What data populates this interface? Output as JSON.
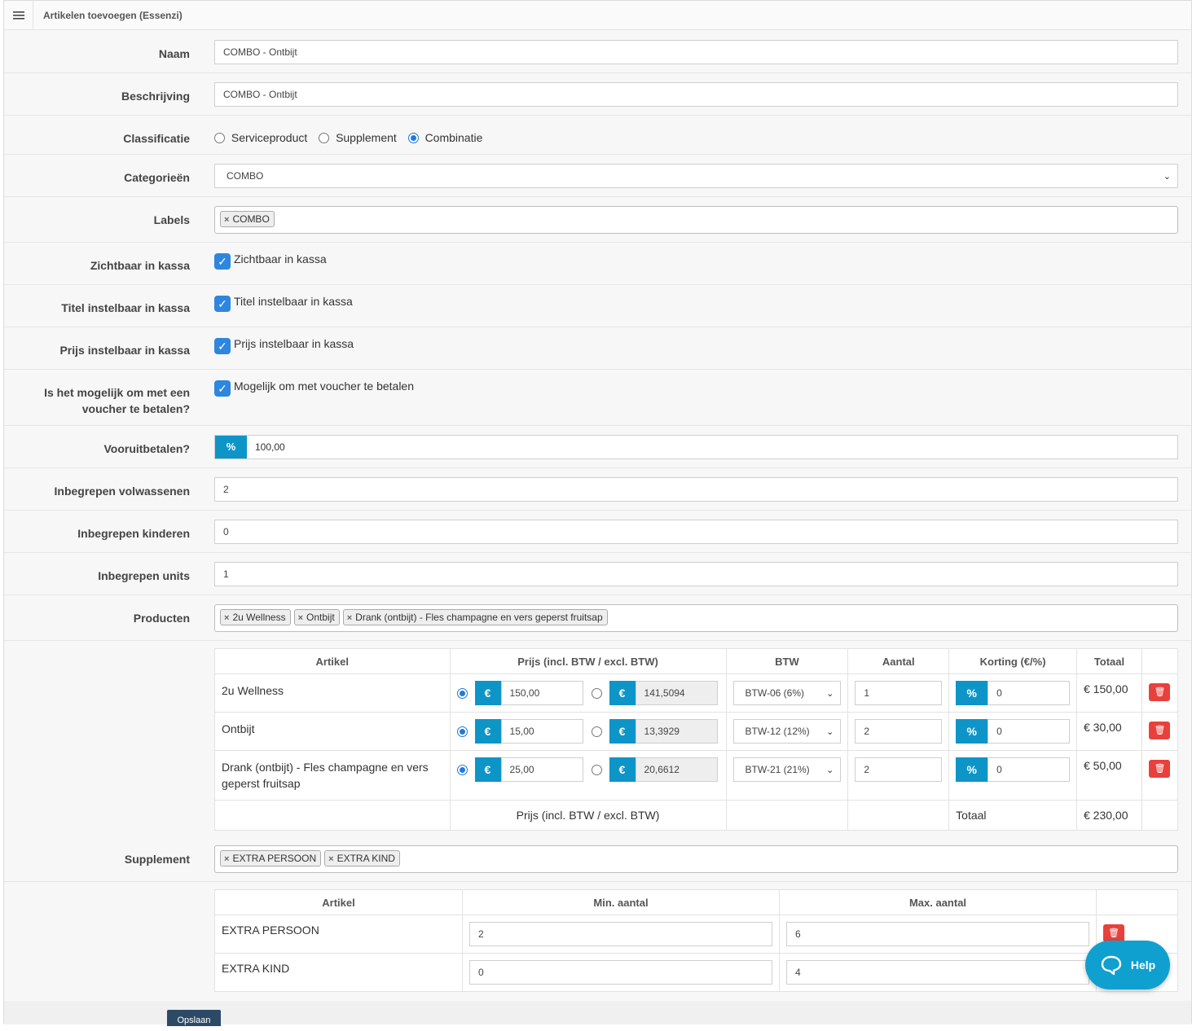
{
  "header": {
    "title": "Artikelen toevoegen (Essenzi)",
    "menu_icon": "hamburger-menu-icon"
  },
  "form": {
    "naam": {
      "label": "Naam",
      "value": "COMBO - Ontbijt"
    },
    "beschrijving": {
      "label": "Beschrijving",
      "value": "COMBO - Ontbijt"
    },
    "classificatie": {
      "label": "Classificatie",
      "options": [
        "Serviceproduct",
        "Supplement",
        "Combinatie"
      ],
      "selected": "Combinatie"
    },
    "categorieen": {
      "label": "Categorieën",
      "value": "COMBO"
    },
    "labels": {
      "label": "Labels",
      "tags": [
        "COMBO"
      ]
    },
    "zichtbaar": {
      "label": "Zichtbaar in kassa",
      "checkbox_label": "Zichtbaar in kassa",
      "checked": true
    },
    "titel": {
      "label": "Titel instelbaar in kassa",
      "checkbox_label": "Titel instelbaar in kassa",
      "checked": true
    },
    "prijs": {
      "label": "Prijs instelbaar in kassa",
      "checkbox_label": "Prijs instelbaar in kassa",
      "checked": true
    },
    "voucher": {
      "label_line1": "Is het mogelijk om met een",
      "label_line2": "voucher te betalen?",
      "checkbox_label": "Mogelijk om met voucher te betalen",
      "checked": true
    },
    "vooruit": {
      "label": "Vooruitbetalen?",
      "addon": "%",
      "value": "100,00"
    },
    "volwassenen": {
      "label": "Inbegrepen volwassenen",
      "value": "2"
    },
    "kinderen": {
      "label": "Inbegrepen kinderen",
      "value": "0"
    },
    "units": {
      "label": "Inbegrepen units",
      "value": "1"
    },
    "producten": {
      "label": "Producten",
      "tags": [
        "2u Wellness",
        "Ontbijt",
        "Drank (ontbijt) - Fles champagne en vers geperst fruitsap"
      ]
    },
    "supplement": {
      "label": "Supplement",
      "tags": [
        "EXTRA PERSOON",
        "EXTRA KIND"
      ]
    }
  },
  "products_table": {
    "headers": [
      "Artikel",
      "Prijs (incl. BTW / excl. BTW)",
      "BTW",
      "Aantal",
      "Korting (€/%)",
      "Totaal"
    ],
    "rows": [
      {
        "artikel": "2u Wellness",
        "incl": "150,00",
        "excl": "141,5094",
        "btw": "BTW-06 (6%)",
        "aantal": "1",
        "korting_type": "%",
        "korting": "0",
        "totaal": "€ 150,00"
      },
      {
        "artikel": "Ontbijt",
        "incl": "15,00",
        "excl": "13,3929",
        "btw": "BTW-12 (12%)",
        "aantal": "2",
        "korting_type": "%",
        "korting": "0",
        "totaal": "€ 30,00"
      },
      {
        "artikel": "Drank (ontbijt) - Fles champagne en vers geperst fruitsap",
        "incl": "25,00",
        "excl": "20,6612",
        "btw": "BTW-21 (21%)",
        "aantal": "2",
        "korting_type": "%",
        "korting": "0",
        "totaal": "€ 50,00"
      }
    ],
    "currency_addon": "€",
    "footer": {
      "prijs_label": "Prijs (incl. BTW / excl. BTW)",
      "totaal_label": "Totaal",
      "totaal": "€ 230,00"
    }
  },
  "supplement_table": {
    "headers": [
      "Artikel",
      "Min. aantal",
      "Max. aantal"
    ],
    "rows": [
      {
        "artikel": "EXTRA PERSOON",
        "min": "2",
        "max": "6"
      },
      {
        "artikel": "EXTRA KIND",
        "min": "0",
        "max": "4"
      }
    ]
  },
  "help": {
    "label": "Help"
  },
  "save": {
    "label": "Opslaan"
  }
}
